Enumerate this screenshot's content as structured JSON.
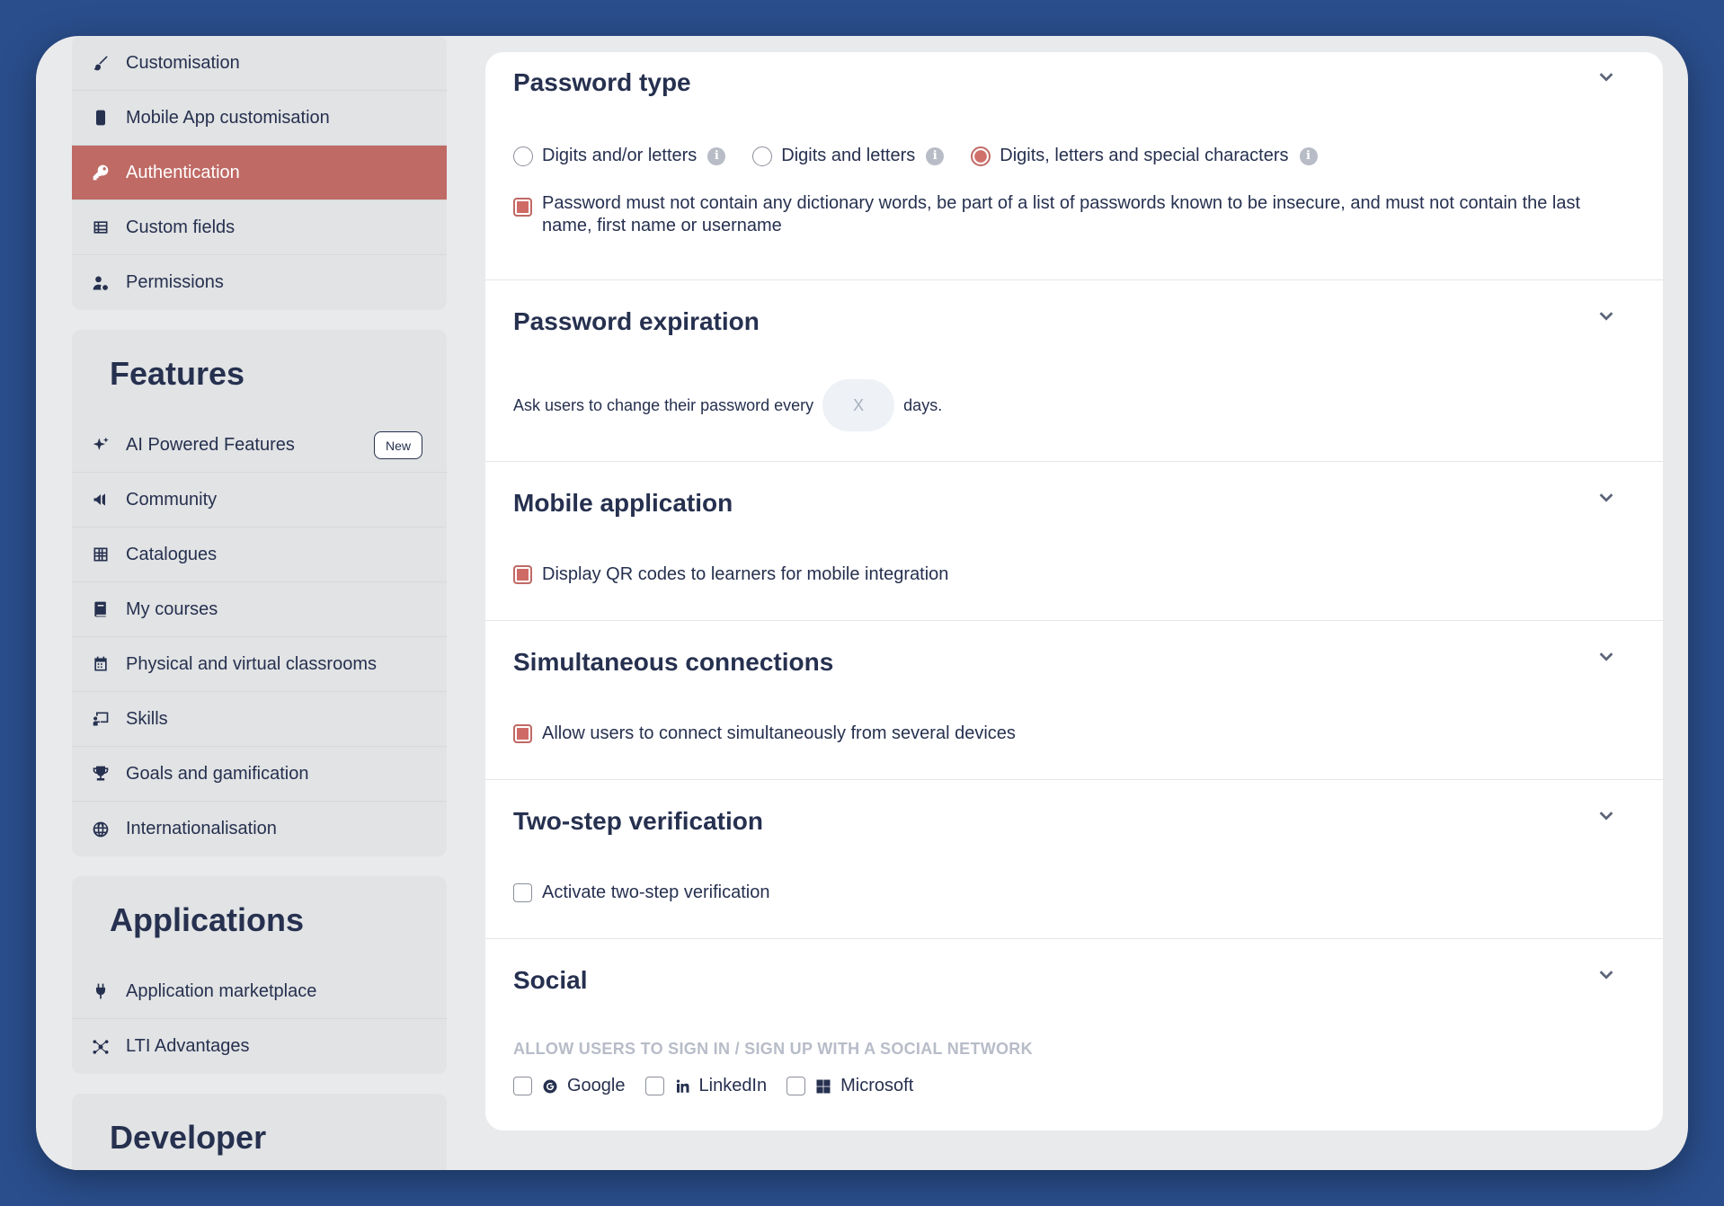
{
  "sidebar": {
    "settings_items": [
      {
        "label": "Customisation",
        "icon": "brush-icon"
      },
      {
        "label": "Mobile App customisation",
        "icon": "mobile-icon"
      },
      {
        "label": "Authentication",
        "icon": "key-icon",
        "active": true
      },
      {
        "label": "Custom fields",
        "icon": "table-icon"
      },
      {
        "label": "Permissions",
        "icon": "user-gear-icon"
      }
    ],
    "features": {
      "title": "Features",
      "items": [
        {
          "label": "AI Powered Features",
          "icon": "sparkles-icon",
          "badge": "New"
        },
        {
          "label": "Community",
          "icon": "megaphone-icon"
        },
        {
          "label": "Catalogues",
          "icon": "grid-icon"
        },
        {
          "label": "My courses",
          "icon": "book-icon"
        },
        {
          "label": "Physical and virtual classrooms",
          "icon": "calendar-icon"
        },
        {
          "label": "Skills",
          "icon": "chalkboard-icon"
        },
        {
          "label": "Goals and gamification",
          "icon": "trophy-icon"
        },
        {
          "label": "Internationalisation",
          "icon": "globe-icon"
        }
      ]
    },
    "applications": {
      "title": "Applications",
      "items": [
        {
          "label": "Application marketplace",
          "icon": "plug-icon"
        },
        {
          "label": "LTI Advantages",
          "icon": "hub-icon"
        }
      ]
    },
    "developer": {
      "title": "Developer"
    }
  },
  "sections": {
    "password_type": {
      "title": "Password type",
      "options": [
        {
          "label": "Digits and/or letters",
          "checked": false
        },
        {
          "label": "Digits and letters",
          "checked": false
        },
        {
          "label": "Digits, letters and special characters",
          "checked": true
        }
      ],
      "dictionary_rule": {
        "line1": "Password must not contain any dictionary words, be part of a list of passwords known to be insecure, and must not contain the last",
        "line2": "name, first name or username",
        "checked": true
      }
    },
    "password_expiration": {
      "title": "Password expiration",
      "prefix": "Ask users to change their password every",
      "placeholder": "X",
      "suffix": "days."
    },
    "mobile_application": {
      "title": "Mobile application",
      "option": "Display QR codes to learners for mobile integration",
      "checked": true
    },
    "simultaneous_connections": {
      "title": "Simultaneous connections",
      "option": "Allow users to connect simultaneously from several devices",
      "checked": true
    },
    "two_step": {
      "title": "Two-step verification",
      "option": "Activate two-step verification",
      "checked": false
    },
    "social": {
      "title": "Social",
      "caption": "ALLOW USERS TO SIGN IN / SIGN UP WITH A SOCIAL NETWORK",
      "networks": [
        {
          "label": "Google",
          "icon": "google-icon",
          "checked": false
        },
        {
          "label": "LinkedIn",
          "icon": "linkedin-icon",
          "checked": false
        },
        {
          "label": "Microsoft",
          "icon": "microsoft-icon",
          "checked": false
        }
      ]
    }
  },
  "colors": {
    "accent": "#bf6a65",
    "text": "#26304f",
    "background": "#2a4e8c"
  }
}
